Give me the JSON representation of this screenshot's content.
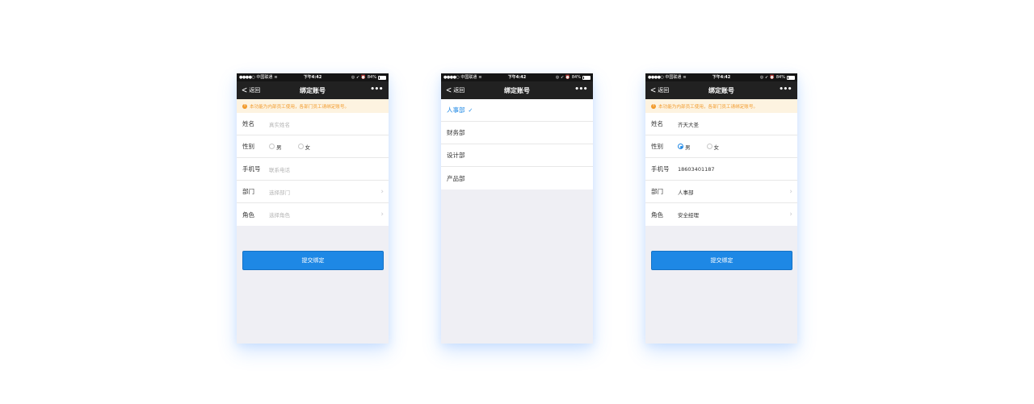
{
  "status_bar": {
    "signal": "●●●●○",
    "carrier": "中国联通",
    "wifi": "≋",
    "time": "下午4:42",
    "icons": "◎ ➶ ⏰",
    "battery": "84%"
  },
  "nav": {
    "back_label": "返回",
    "title": "绑定账号",
    "more": "•••"
  },
  "notice": {
    "icon": "!",
    "text": "本功能为内部员工使用，各部门员工请绑定账号。"
  },
  "form_labels": {
    "name": "姓名",
    "gender": "性别",
    "phone": "手机号",
    "department": "部门",
    "role": "角色"
  },
  "gender_options": {
    "male": "男",
    "female": "女"
  },
  "screen_empty": {
    "name_placeholder": "真实姓名",
    "phone_placeholder": "联系电话",
    "department_placeholder": "选择部门",
    "role_placeholder": "选择角色",
    "gender_selected": "none"
  },
  "screen_filled": {
    "name": "齐天大圣",
    "phone": "18603401187",
    "department": "人事部",
    "role": "安全经理",
    "gender_selected": "男"
  },
  "department_picker": {
    "items": [
      "人事部",
      "财务部",
      "设计部",
      "产品部"
    ],
    "selected": "人事部",
    "check": "✓"
  },
  "submit_label": "提交绑定",
  "arrow": "›",
  "colors": {
    "accent": "#1e88e5",
    "nav_bg": "#212121",
    "notice_bg": "#fdf3e0",
    "notice_text": "#f29b2c",
    "page_bg": "#efeff4"
  }
}
